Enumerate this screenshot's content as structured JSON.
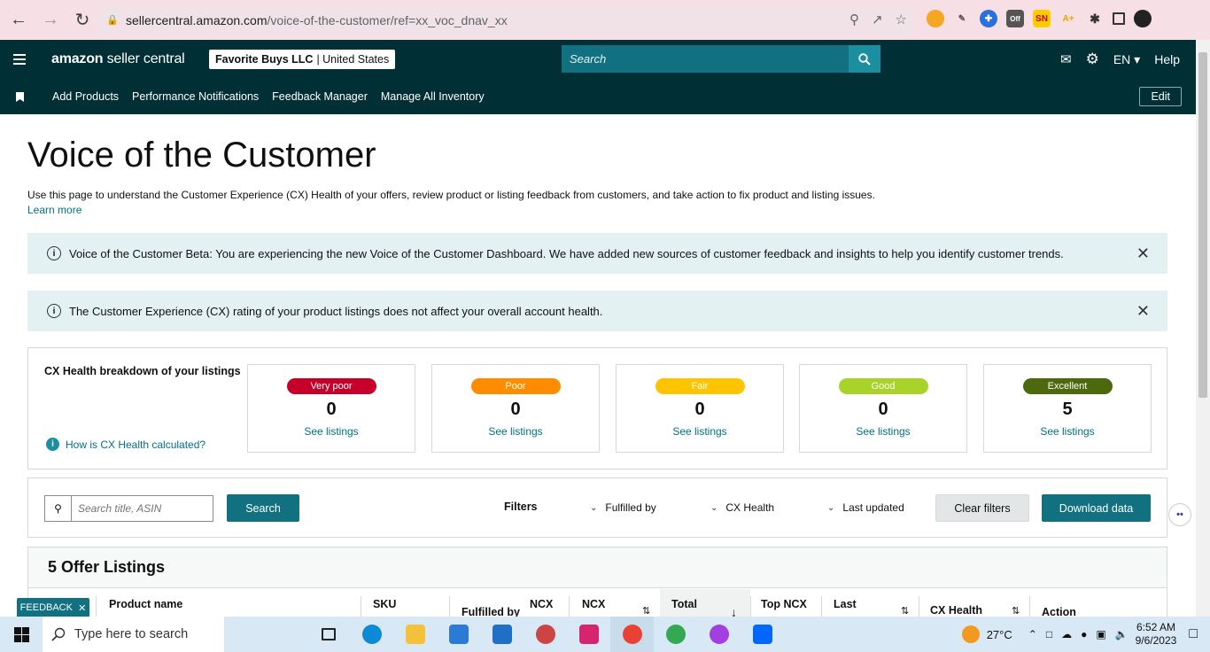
{
  "browser": {
    "url_domain": "sellercentral.amazon.com",
    "url_path": "/voice-of-the-customer/ref=xx_voc_dnav_xx"
  },
  "header": {
    "logo_bold": "amazon",
    "logo_light": " seller central",
    "account_name": "Favorite Buys LLC",
    "account_region": "| United States",
    "search_placeholder": "Search",
    "language": "EN",
    "help": "Help"
  },
  "subnav": {
    "links": [
      "Add Products",
      "Performance Notifications",
      "Feedback Manager",
      "Manage All Inventory"
    ],
    "edit": "Edit"
  },
  "page": {
    "title": "Voice of the Customer",
    "description": "Use this page to understand the Customer Experience (CX) Health of your offers, review product or listing feedback from customers, and take action to fix product and listing issues.",
    "learn_more": "Learn more"
  },
  "alerts": [
    {
      "text": "Voice of the Customer Beta: You are experiencing the new Voice of the Customer Dashboard. We have added new sources of customer feedback and insights to help you identify customer trends.",
      "bold": true
    },
    {
      "text": "The Customer Experience (CX) rating of your product listings does not affect your overall account health.",
      "bold": true
    }
  ],
  "cx_health": {
    "title": "CX Health breakdown of your listings",
    "help_link": "How is CX Health calculated?",
    "cards": [
      {
        "label": "Very poor",
        "count": "0",
        "link": "See listings",
        "color": "#c7002a",
        "text_color": "#ffffff"
      },
      {
        "label": "Poor",
        "count": "0",
        "link": "See listings",
        "color": "#ff8c00",
        "text_color": "#ffffff"
      },
      {
        "label": "Fair",
        "count": "0",
        "link": "See listings",
        "color": "#ffc400",
        "text_color": "#ffffff"
      },
      {
        "label": "Good",
        "count": "0",
        "link": "See listings",
        "color": "#a8d42a",
        "text_color": "#ffffff"
      },
      {
        "label": "Excellent",
        "count": "5",
        "link": "See listings",
        "color": "#4c6a0d",
        "text_color": "#ffffff"
      }
    ]
  },
  "filters": {
    "search_placeholder": "Search title, ASIN",
    "search_button": "Search",
    "filters_label": "Filters",
    "dropdowns": [
      "Fulfilled by",
      "CX Health",
      "Last updated"
    ],
    "clear": "Clear filters",
    "download": "Download data"
  },
  "listings": {
    "title": "5 Offer Listings",
    "columns": [
      "Product name",
      "SKU",
      "Fulfilled by",
      "NCX",
      "NCX",
      "Total",
      "Top NCX",
      "Last",
      "CX Health",
      "Action"
    ]
  },
  "feedback_tab": "FEEDBACK",
  "taskbar": {
    "search_placeholder": "Type here to search",
    "temperature": "27°C",
    "time": "6:52 AM",
    "date": "9/6/2023"
  }
}
